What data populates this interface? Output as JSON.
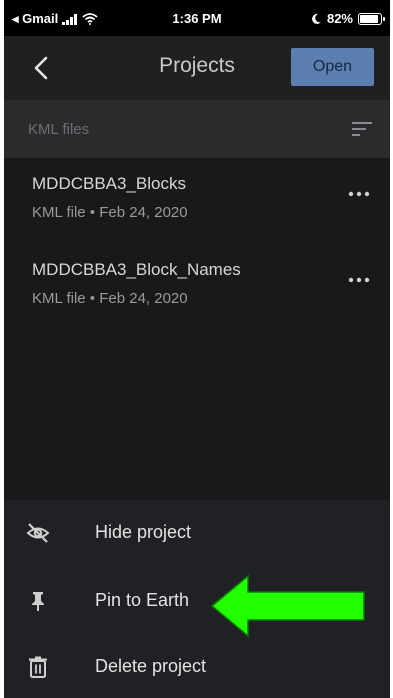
{
  "status_bar": {
    "carrier": "◂ Gmail",
    "time": "1:36 PM",
    "battery": "82%",
    "battery_level": 0.82
  },
  "header": {
    "title": "Projects",
    "open_label": "Open"
  },
  "section": {
    "label": "KML files"
  },
  "files": [
    {
      "name": "MDDCBBA3_Blocks",
      "meta": "KML file • Feb 24, 2020"
    },
    {
      "name": "MDDCBBA3_Block_Names",
      "meta": "KML file • Feb 24, 2020"
    }
  ],
  "sheet": {
    "items": [
      {
        "label": "Hide project",
        "icon": "hide-icon"
      },
      {
        "label": "Pin to Earth",
        "icon": "pin-icon"
      },
      {
        "label": "Delete project",
        "icon": "trash-icon"
      }
    ]
  },
  "colors": {
    "background": "#18191b",
    "open_button": "#5b7fae",
    "annotation_arrow": "#22ff00"
  }
}
